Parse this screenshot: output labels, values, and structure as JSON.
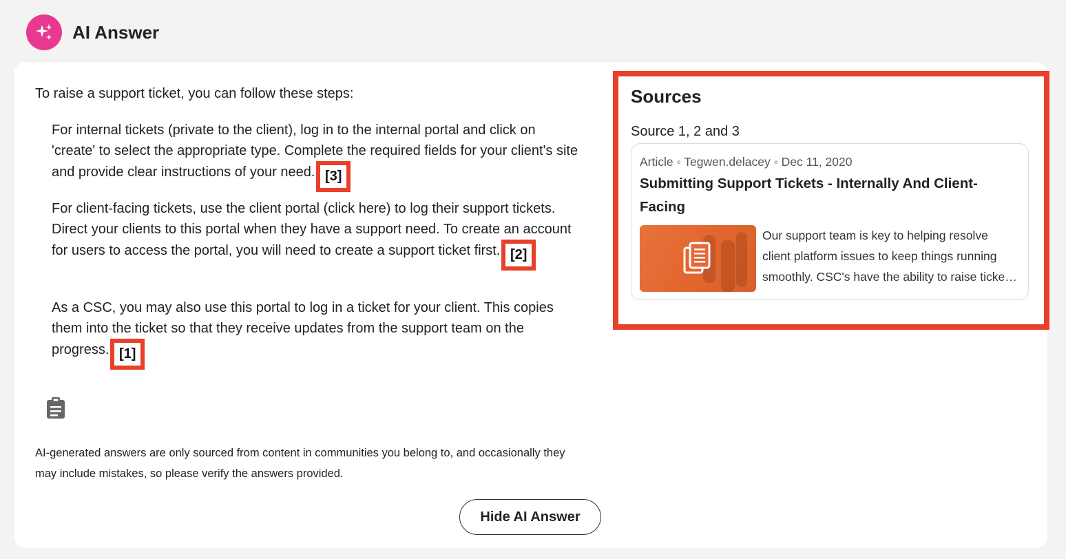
{
  "header": {
    "title": "AI Answer",
    "icon": "sparkles-icon",
    "badge_color": "#e8388f"
  },
  "answer": {
    "intro": "To raise a support ticket, you can follow these steps:",
    "paragraphs": [
      {
        "text": "For internal tickets (private to the client), log in to the internal portal and click on 'create' to select the appropriate type. Complete the required fields for your client's site and provide clear instructions of your need.",
        "citation": "[3]"
      },
      {
        "text": "For client-facing tickets, use the client portal (click here) to log their support tickets. Direct your clients to this portal when they have a support need. To create an account for users to access the portal, you will need to create a support ticket first.",
        "citation": "[2]"
      },
      {
        "text": "As a CSC, you may also use this portal to log in a ticket for your client. This copies them into the ticket so that they receive updates from the support team on the progress.",
        "citation": "[1]"
      }
    ],
    "copy_icon": "clipboard-icon",
    "disclaimer": "AI-generated answers are only sourced from content in communities you belong to, and occasionally they may include mistakes, so please verify the answers provided.",
    "hide_button": "Hide AI Answer"
  },
  "sources": {
    "title": "Sources",
    "subtitle": "Source 1, 2 and 3",
    "card": {
      "meta": "Article ◦ Tegwen.delacey ◦ Dec 11, 2020",
      "title": "Submitting Support Tickets - Internally And Client-Facing",
      "excerpt": "Our support team is key to helping resolve client platform issues to keep things running smoothly. CSC's have the ability to raise tickets on behalf of their clients.",
      "thumbnail_icon": "document-icon"
    }
  },
  "colors": {
    "highlight": "#e8402a",
    "accent": "#e8388f",
    "thumbnail": "#e2672f"
  }
}
